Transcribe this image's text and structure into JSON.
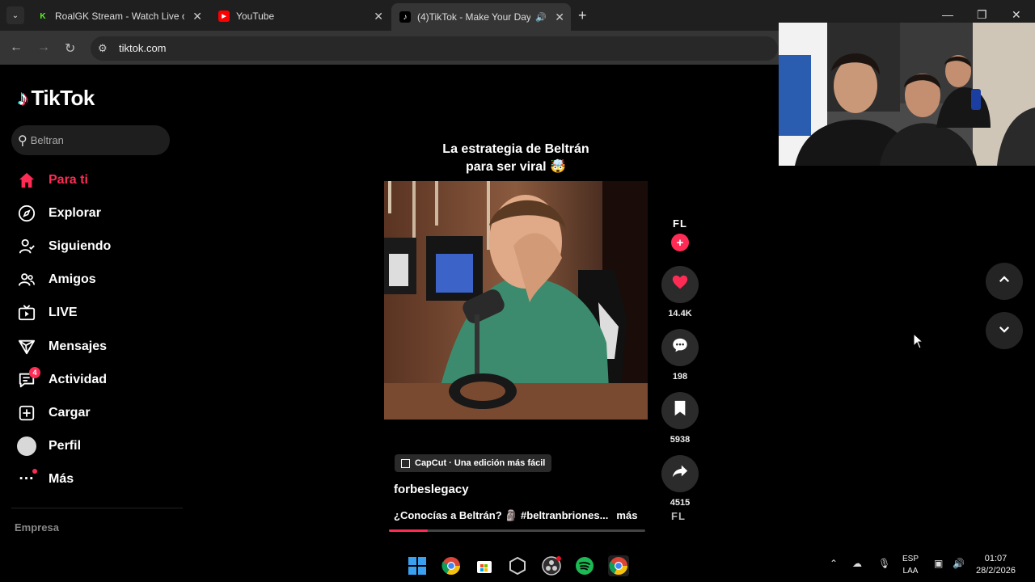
{
  "browser": {
    "tabs": [
      {
        "title": "RoalGK Stream - Watch Live on",
        "favicon": "K"
      },
      {
        "title": "YouTube",
        "favicon": "▶"
      },
      {
        "title": "(4)TikTok - Make Your Day",
        "favicon": "♪",
        "audio_icon": "🔊",
        "active": true
      }
    ],
    "new_tab_label": "+",
    "url": "tiktok.com"
  },
  "tiktok": {
    "logo_text": "TikTok",
    "search": {
      "value": "Beltran"
    },
    "nav": [
      {
        "label": "Para ti",
        "icon": "home-icon",
        "active": true
      },
      {
        "label": "Explorar",
        "icon": "compass-icon"
      },
      {
        "label": "Siguiendo",
        "icon": "following-icon"
      },
      {
        "label": "Amigos",
        "icon": "friends-icon"
      },
      {
        "label": "LIVE",
        "icon": "live-tv-icon"
      },
      {
        "label": "Mensajes",
        "icon": "send-icon"
      },
      {
        "label": "Actividad",
        "icon": "activity-icon",
        "badge": "4"
      },
      {
        "label": "Cargar",
        "icon": "upload-icon"
      },
      {
        "label": "Perfil",
        "icon": "avatar-icon"
      },
      {
        "label": "Más",
        "icon": "more-icon"
      }
    ],
    "footer_section": "Empresa",
    "video": {
      "caption_line1": "La estrategia de Beltrán",
      "caption_line2": "para ser viral 🤯",
      "capcut_label": "CapCut · Una edición más fácil",
      "author": "forbeslegacy",
      "description": "¿Conocías a Beltrán? 🗿 #beltranbriones...",
      "more_label": "más",
      "progress": 0.15,
      "creator_avatar_text": "FL",
      "likes": "14.4K",
      "comments": "198",
      "saves": "5938",
      "shares": "4515",
      "music_disc_text": "FL"
    }
  },
  "taskbar": {
    "lang_line1": "ESP",
    "lang_line2": "LAA",
    "time": "01:07",
    "date": "28/2/2026"
  },
  "colors": {
    "tiktok_red": "#fe2c55",
    "tab_bg": "#1f1f1f",
    "active_tab_bg": "#353535"
  }
}
